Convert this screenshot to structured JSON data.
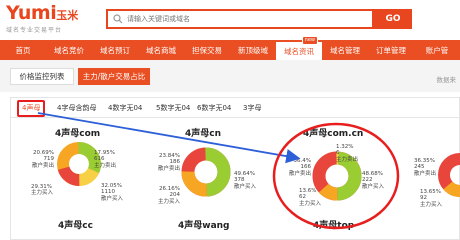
{
  "header": {
    "logo_text": "Yumi",
    "logo_cn": "玉米",
    "slogan": "域名专业交易平台",
    "search_placeholder": "请输入关键词或域名",
    "go_label": "GO"
  },
  "nav": {
    "items": [
      {
        "label": "首页"
      },
      {
        "label": "域名竞价"
      },
      {
        "label": "域名预订"
      },
      {
        "label": "域名商城"
      },
      {
        "label": "担保交易"
      },
      {
        "label": "新顶级域"
      },
      {
        "label": "域名资讯",
        "badge": "new",
        "active": true
      },
      {
        "label": "域名管理"
      },
      {
        "label": "订单管理"
      },
      {
        "label": "账户管"
      }
    ]
  },
  "subtabs": {
    "tab1": "价格监控列表",
    "tab2": "主力/散户交易占比",
    "data_source": "数据来"
  },
  "categories": {
    "items": [
      "4声母",
      "4字母含韵母",
      "4数字无04",
      "5数字无04",
      "6数字无04",
      "3字母"
    ]
  },
  "charts": {
    "c1": {
      "title": "4声母com",
      "l1": "20.69%",
      "l2": "719",
      "l3": "散户卖出",
      "l4": "29.31%",
      "l5": "主力买入",
      "r1": "17.95%",
      "r2": "616",
      "r3": "主力卖出",
      "r4": "32.05%",
      "r5": "1110",
      "r6": "散户买入"
    },
    "c2": {
      "title": "4声母cn",
      "l1": "23.84%",
      "l2": "186",
      "l3": "散户卖出",
      "l4": "26.16%",
      "l5": "204",
      "l6": "主力买入",
      "r1": "49.64%",
      "r2": "378",
      "r3": "散户买入"
    },
    "c3": {
      "title": "4声母com.cn",
      "t1": "1.32%",
      "t2": "6",
      "t3": "主力卖出",
      "l1": "36.4%",
      "l2": "166",
      "l3": "散户卖出",
      "l4": "13.6%",
      "l5": "62",
      "l6": "主力买入",
      "r1": "48.68%",
      "r2": "222",
      "r3": "散户买入"
    },
    "c4": {
      "l1": "36.35%",
      "l2": "245",
      "l3": "散户卖出",
      "l4": "13.65%",
      "l5": "92",
      "l6": "主力买入"
    }
  },
  "bottom_titles": {
    "b1": "4声母cc",
    "b2": "4声母wang",
    "b3": "4声母top"
  },
  "chart_colors": {
    "red": "#e8453c",
    "orange": "#f6a623",
    "green": "#9acd32",
    "yellow": "#f7d046"
  }
}
